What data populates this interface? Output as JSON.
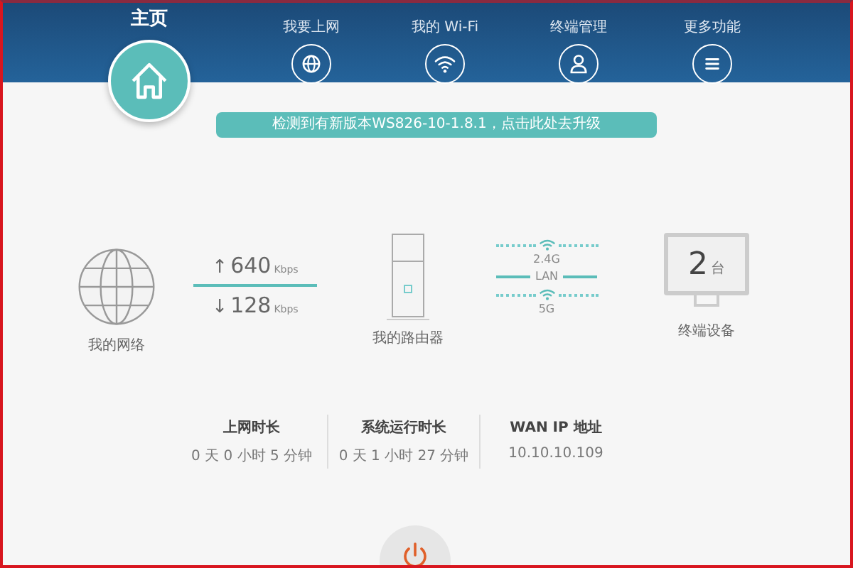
{
  "tabs": [
    {
      "label": "主页",
      "selected": true
    },
    {
      "label": "我要上网",
      "selected": false
    },
    {
      "label": "我的 Wi-Fi",
      "selected": false
    },
    {
      "label": "终端管理",
      "selected": false
    },
    {
      "label": "更多功能",
      "selected": false
    }
  ],
  "banner": {
    "text": "检测到有新版本WS826-10-1.8.1，点击此处去升级"
  },
  "network": {
    "label": "我的网络"
  },
  "speeds": [
    {
      "arrow": "↑",
      "value": "640",
      "unit": "Kbps"
    },
    {
      "arrow": "↓",
      "value": "128",
      "unit": "Kbps"
    }
  ],
  "router": {
    "label": "我的路由器"
  },
  "links": {
    "top": "2.4G",
    "middle": "LAN",
    "bottom": "5G"
  },
  "devices": {
    "count": "2",
    "unit": "台",
    "label": "终端设备"
  },
  "status": [
    {
      "label": "上网时长",
      "value": "0 天 0 小时 5 分钟"
    },
    {
      "label": "系统运行时长",
      "value": "0 天 1 小时 27 分钟"
    },
    {
      "label": "WAN IP 地址",
      "value": "10.10.10.109"
    }
  ]
}
